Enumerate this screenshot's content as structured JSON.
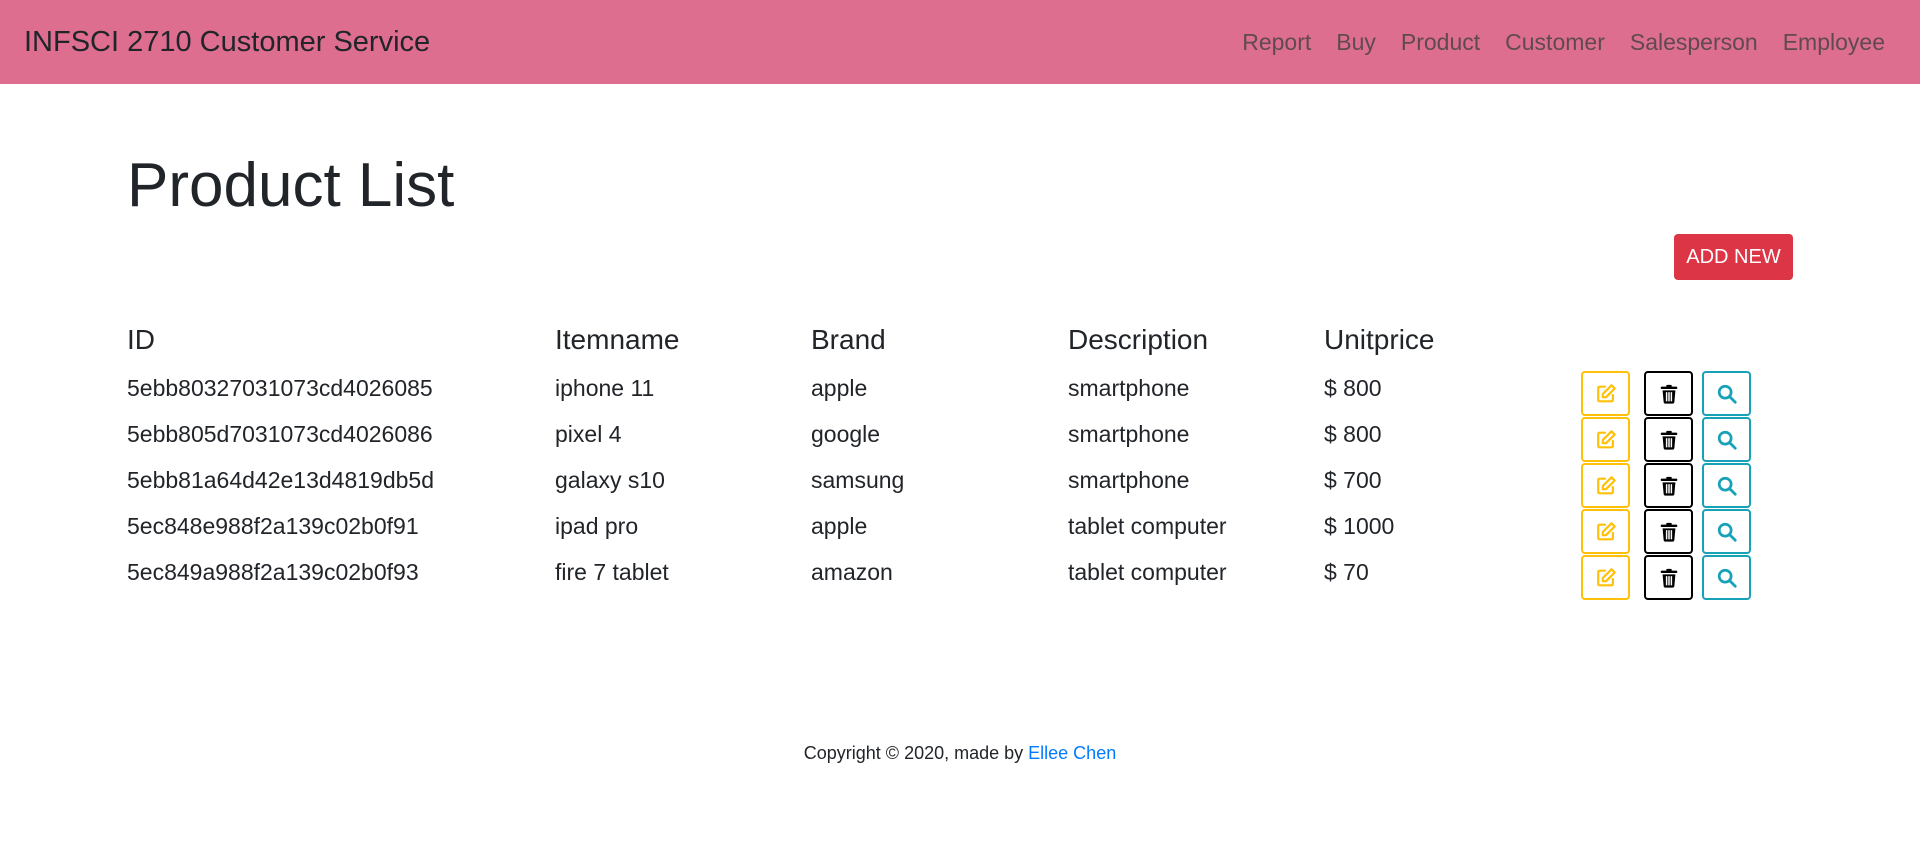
{
  "navbar": {
    "brand": "INFSCI 2710 Customer Service",
    "links": [
      "Report",
      "Buy",
      "Product",
      "Customer",
      "Salesperson",
      "Employee"
    ]
  },
  "page": {
    "title": "Product List",
    "add_button": "ADD NEW"
  },
  "table": {
    "headers": [
      "ID",
      "Itemname",
      "Brand",
      "Description",
      "Unitprice"
    ],
    "rows": [
      {
        "id": "5ebb80327031073cd4026085",
        "itemname": "iphone 11",
        "brand": "apple",
        "description": "smartphone",
        "unitprice": "$ 800"
      },
      {
        "id": "5ebb805d7031073cd4026086",
        "itemname": "pixel 4",
        "brand": "google",
        "description": "smartphone",
        "unitprice": "$ 800"
      },
      {
        "id": "5ebb81a64d42e13d4819db5d",
        "itemname": "galaxy s10",
        "brand": "samsung",
        "description": "smartphone",
        "unitprice": "$ 700"
      },
      {
        "id": "5ec848e988f2a139c02b0f91",
        "itemname": "ipad pro",
        "brand": "apple",
        "description": "tablet computer",
        "unitprice": "$ 1000"
      },
      {
        "id": "5ec849a988f2a139c02b0f93",
        "itemname": "fire 7 tablet",
        "brand": "amazon",
        "description": "tablet computer",
        "unitprice": "$ 70"
      }
    ],
    "row_actions": [
      {
        "name": "edit",
        "icon": "edit-icon"
      },
      {
        "name": "delete",
        "icon": "trash-icon"
      },
      {
        "name": "view",
        "icon": "search-icon"
      }
    ]
  },
  "footer": {
    "text": "Copyright © 2020, made by ",
    "author": "Ellee Chen"
  },
  "colors": {
    "navbar": "#de6e8f",
    "add_button": "#dc3545",
    "edit": "#ffc107",
    "delete": "#343a40",
    "view": "#17a2b8",
    "link": "#007bff"
  }
}
